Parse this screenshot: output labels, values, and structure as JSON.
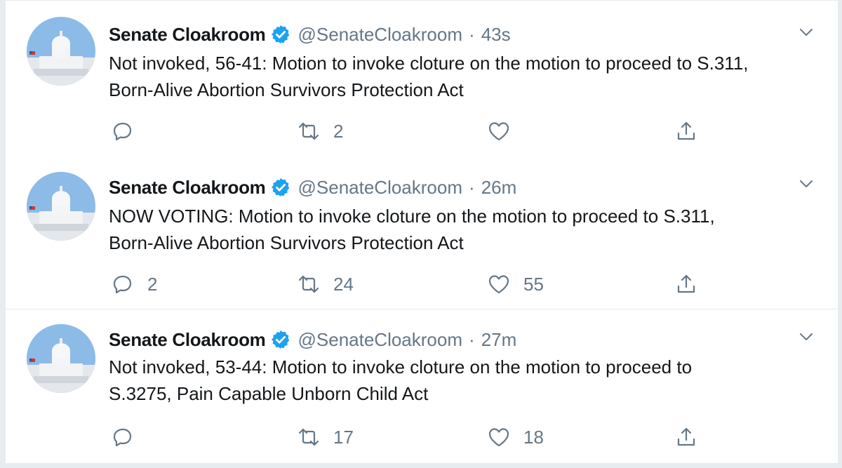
{
  "tweets": [
    {
      "name": "Senate Cloakroom",
      "handle": "@SenateCloakroom",
      "separator": "·",
      "time": "43s",
      "text_line1": "Not invoked, 56-41: Motion to invoke cloture on the motion to proceed to S.311,",
      "text_line2": "Born-Alive Abortion Survivors Protection Act",
      "replies": "",
      "retweets": "2",
      "likes": ""
    },
    {
      "name": "Senate Cloakroom",
      "handle": "@SenateCloakroom",
      "separator": "·",
      "time": "26m",
      "text_line1": "NOW VOTING: Motion to invoke cloture on the motion to proceed to S.311,",
      "text_line2": "Born-Alive Abortion Survivors Protection Act",
      "replies": "2",
      "retweets": "24",
      "likes": "55"
    },
    {
      "name": "Senate Cloakroom",
      "handle": "@SenateCloakroom",
      "separator": "·",
      "time": "27m",
      "text_line1": "Not invoked, 53-44: Motion to invoke cloture on the motion to proceed to",
      "text_line2": "S.3275, Pain Capable Unborn Child Act",
      "replies": "",
      "retweets": "17",
      "likes": "18"
    }
  ],
  "icons": {
    "verified": "verified-badge-icon",
    "chevron": "chevron-down-icon",
    "reply": "reply-icon",
    "retweet": "retweet-icon",
    "like": "heart-icon",
    "share": "share-icon"
  },
  "colors": {
    "verified_blue": "#1da1f2",
    "muted_text": "#657786",
    "primary_text": "#14171a",
    "divider": "#e6ecf0"
  }
}
